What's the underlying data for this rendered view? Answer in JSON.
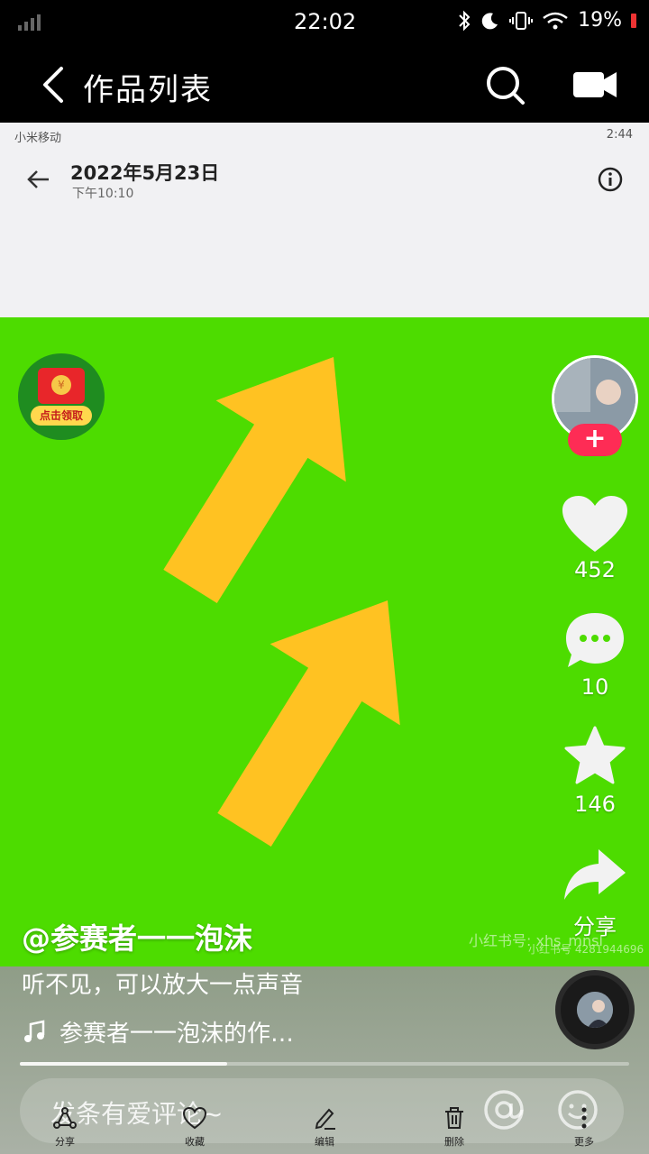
{
  "status_bar": {
    "time": "22:02",
    "battery": "19%",
    "icons": [
      "signal-icon",
      "bluetooth-icon",
      "moon-icon",
      "vibrate-icon",
      "wifi-icon",
      "battery-icon"
    ]
  },
  "header": {
    "title": "作品列表",
    "back_icon": "chevron-left-icon",
    "search_icon": "search-icon",
    "camera_icon": "video-camera-icon"
  },
  "inner_screenshot": {
    "carrier": "小米移动",
    "time": "2:44",
    "date": "2022年5月23日",
    "subtime": "下午10:10"
  },
  "red_packet": {
    "label": "点击领取"
  },
  "rail": {
    "likes": "452",
    "comments": "10",
    "favorites": "146",
    "share_label": "分享"
  },
  "watermark": {
    "line1": "小红书号: xhs_mnsl",
    "line2": "小红书号 4281944696"
  },
  "post": {
    "author": "@参赛者一一泡沫",
    "description": "听不见，可以放大一点声音",
    "music": "参赛者一一泡沫的作…",
    "progress_fraction": 0.34
  },
  "comment": {
    "placeholder": "发条有爱评论~"
  },
  "toolbar": {
    "items": [
      {
        "label": "分享",
        "icon": "share-icon"
      },
      {
        "label": "收藏",
        "icon": "heart-outline-icon"
      },
      {
        "label": "编辑",
        "icon": "edit-icon"
      },
      {
        "label": "删除",
        "icon": "trash-icon"
      },
      {
        "label": "更多",
        "icon": "more-icon"
      }
    ]
  },
  "colors": {
    "video_bg": "#4ddc00",
    "arrow": "#ffc222",
    "follow": "#fe2c55"
  }
}
